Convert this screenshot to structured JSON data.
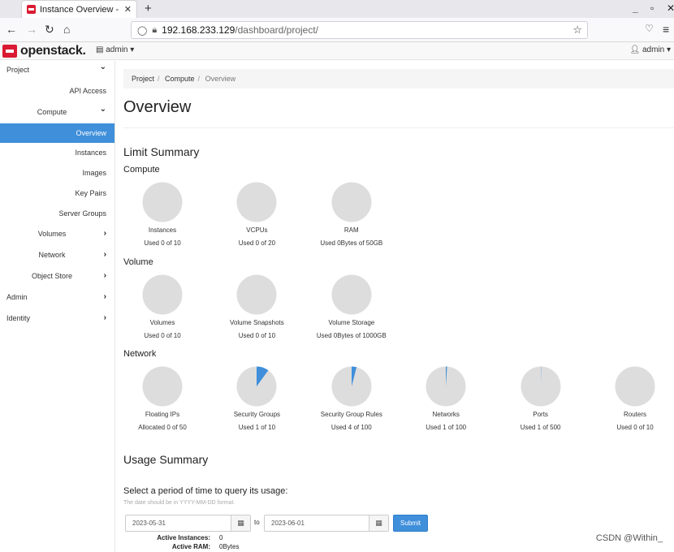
{
  "browser": {
    "tab_title": "Instance Overview - Open",
    "tab_close": "✕",
    "new_tab": "+",
    "url_host": "192.168.233.129",
    "url_path": "/dashboard/project/",
    "window_controls": [
      "_",
      "▫",
      "✕"
    ]
  },
  "header": {
    "logo_text": "openstack.",
    "project_menu": "admin ▾",
    "user_menu": "admin ▾"
  },
  "sidebar": {
    "items": [
      {
        "label": "Project",
        "chevron": "down"
      },
      {
        "label": "API Access"
      },
      {
        "label": "Compute",
        "chevron": "down"
      },
      {
        "label": "Overview",
        "active": true
      },
      {
        "label": "Instances"
      },
      {
        "label": "Images"
      },
      {
        "label": "Key Pairs"
      },
      {
        "label": "Server Groups"
      },
      {
        "label": "Volumes",
        "chevron": "right"
      },
      {
        "label": "Network",
        "chevron": "right"
      },
      {
        "label": "Object Store",
        "chevron": "right"
      },
      {
        "label": "Admin",
        "chevron": "right"
      },
      {
        "label": "Identity",
        "chevron": "right"
      }
    ]
  },
  "breadcrumb": [
    "Project",
    "Compute",
    "Overview"
  ],
  "page_title": "Overview",
  "limit_summary": {
    "title": "Limit Summary",
    "compute": {
      "heading": "Compute",
      "charts": [
        {
          "label": "Instances",
          "used_text": "Used 0 of 10",
          "fraction": 0
        },
        {
          "label": "VCPUs",
          "used_text": "Used 0 of 20",
          "fraction": 0
        },
        {
          "label": "RAM",
          "used_text": "Used 0Bytes of 50GB",
          "fraction": 0
        }
      ]
    },
    "volume": {
      "heading": "Volume",
      "charts": [
        {
          "label": "Volumes",
          "used_text": "Used 0 of 10",
          "fraction": 0
        },
        {
          "label": "Volume Snapshots",
          "used_text": "Used 0 of 10",
          "fraction": 0
        },
        {
          "label": "Volume Storage",
          "used_text": "Used 0Bytes of 1000GB",
          "fraction": 0
        }
      ]
    },
    "network": {
      "heading": "Network",
      "charts": [
        {
          "label": "Floating IPs",
          "used_text": "Allocated 0 of 50",
          "fraction": 0
        },
        {
          "label": "Security Groups",
          "used_text": "Used 1 of 10",
          "fraction": 0.1
        },
        {
          "label": "Security Group Rules",
          "used_text": "Used 4 of 100",
          "fraction": 0.04
        },
        {
          "label": "Networks",
          "used_text": "Used 1 of 100",
          "fraction": 0.01
        },
        {
          "label": "Ports",
          "used_text": "Used 1 of 500",
          "fraction": 0.002
        },
        {
          "label": "Routers",
          "used_text": "Used 0 of 10",
          "fraction": 0
        }
      ]
    }
  },
  "usage_summary": {
    "title": "Usage Summary",
    "query_title": "Select a period of time to query its usage:",
    "hint": "The date should be in YYYY-MM-DD format.",
    "start_date": "2023-05-31",
    "to_label": "to",
    "end_date": "2023-06-01",
    "submit_label": "Submit",
    "stats": [
      {
        "key": "Active Instances:",
        "value": "0"
      },
      {
        "key": "Active RAM:",
        "value": "0Bytes"
      }
    ]
  },
  "colors": {
    "pie_bg": "#dddddd",
    "pie_fill": "#3f8fdb",
    "accent": "#3f8fdb",
    "brand": "#da1a32"
  },
  "watermark": "CSDN @Within_"
}
